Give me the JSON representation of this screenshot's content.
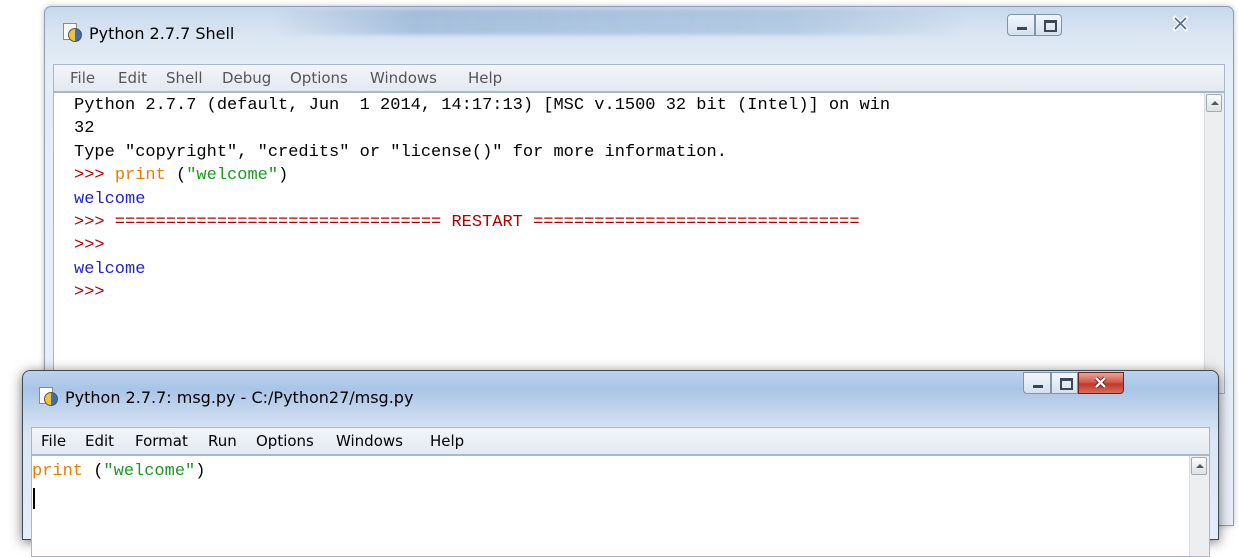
{
  "shell": {
    "title": "Python 2.7.7 Shell",
    "menu": [
      "File",
      "Edit",
      "Shell",
      "Debug",
      "Options",
      "Windows",
      "Help"
    ],
    "lines": [
      {
        "segments": [
          {
            "text": "Python 2.7.7 (default, Jun  1 2014, 14:17:13) [MSC v.1500 32 bit (Intel)] on win",
            "cls": ""
          }
        ]
      },
      {
        "segments": [
          {
            "text": "32",
            "cls": ""
          }
        ]
      },
      {
        "segments": [
          {
            "text": "Type \"copyright\", \"credits\" or \"license()\" for more information.",
            "cls": ""
          }
        ]
      },
      {
        "segments": [
          {
            "text": ">>> ",
            "cls": "prompt"
          },
          {
            "text": "print",
            "cls": "kw"
          },
          {
            "text": " (",
            "cls": ""
          },
          {
            "text": "\"welcome\"",
            "cls": "str"
          },
          {
            "text": ")",
            "cls": ""
          }
        ]
      },
      {
        "segments": [
          {
            "text": "welcome",
            "cls": "out"
          }
        ]
      },
      {
        "segments": [
          {
            "text": ">>> ================================ RESTART ================================",
            "cls": "prompt"
          }
        ]
      },
      {
        "segments": [
          {
            "text": ">>> ",
            "cls": "prompt"
          }
        ]
      },
      {
        "segments": [
          {
            "text": "welcome",
            "cls": "out"
          }
        ]
      },
      {
        "segments": [
          {
            "text": ">>> ",
            "cls": "prompt"
          }
        ]
      }
    ]
  },
  "editor": {
    "title": "Python 2.7.7: msg.py - C:/Python27/msg.py",
    "menu": [
      "File",
      "Edit",
      "Format",
      "Run",
      "Options",
      "Windows",
      "Help"
    ],
    "lines": [
      {
        "segments": [
          {
            "text": "print",
            "cls": "kw"
          },
          {
            "text": " (",
            "cls": ""
          },
          {
            "text": "\"welcome\"",
            "cls": "str"
          },
          {
            "text": ")",
            "cls": ""
          }
        ]
      }
    ]
  },
  "colors": {
    "prompt": "#b50000",
    "keyword": "#e67e00",
    "string": "#1c9a22",
    "output": "#2323d6",
    "close_button_active": "#c9463d"
  },
  "icons": {
    "app": "python-idle-icon",
    "minimize": "minimize-icon",
    "maximize": "maximize-icon",
    "close": "close-icon",
    "scroll_up": "scroll-up-arrow-icon"
  }
}
